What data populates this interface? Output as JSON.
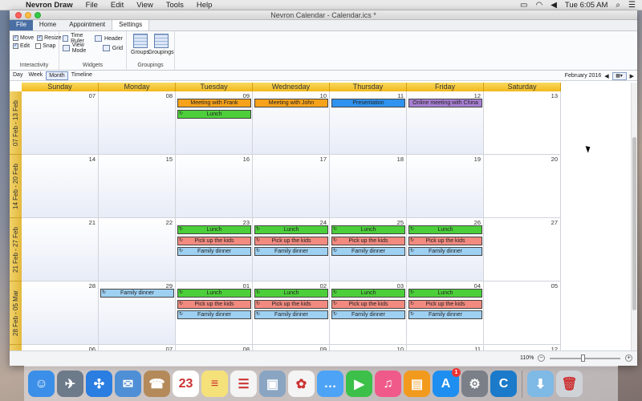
{
  "menubar": {
    "app_name": "Nevron Draw",
    "items": [
      "File",
      "Edit",
      "View",
      "Tools",
      "Help"
    ],
    "clock": "Tue 6:05 AM"
  },
  "window": {
    "title": "Nevron Calendar - Calendar.ics *"
  },
  "ribbon": {
    "tabs": [
      "File",
      "Home",
      "Appointment",
      "Settings"
    ],
    "interactivity": {
      "move": "Move",
      "resize": "Resize",
      "edit": "Edit",
      "snap": "Snap",
      "label": "Interactivity"
    },
    "widgets": {
      "time_ruler": "Time Ruler",
      "header": "Header",
      "view_mode": "View Mode",
      "grid": "Grid",
      "label": "Widgets"
    },
    "groupings": {
      "groups": "Groups",
      "groupings": "Groupings",
      "label": "Groupings"
    }
  },
  "viewbar": {
    "modes": [
      "Day",
      "Week",
      "Month",
      "Timeline"
    ],
    "selected": "Month",
    "period": "February 2016"
  },
  "calendar": {
    "day_headers": [
      "Sunday",
      "Monday",
      "Tuesday",
      "Wednesday",
      "Thursday",
      "Friday",
      "Saturday"
    ],
    "weeks": [
      {
        "label": "07 Feb - 13 Feb",
        "days": [
          "07",
          "08",
          "09",
          "10",
          "11",
          "12",
          "13"
        ]
      },
      {
        "label": "14 Feb - 20 Feb",
        "days": [
          "14",
          "15",
          "16",
          "17",
          "18",
          "19",
          "20"
        ]
      },
      {
        "label": "21 Feb - 27 Feb",
        "days": [
          "21",
          "22",
          "23",
          "24",
          "25",
          "26",
          "27"
        ]
      },
      {
        "label": "28 Feb - 05 Mar",
        "days": [
          "28",
          "29",
          "01",
          "02",
          "03",
          "04",
          "05"
        ]
      },
      {
        "label": "",
        "days": [
          "06",
          "07",
          "08",
          "09",
          "10",
          "11",
          "12"
        ]
      }
    ],
    "appointments": [
      {
        "week": 0,
        "day": 2,
        "slot": 0,
        "text": "Meeting with Frank",
        "color": "#f7a21b",
        "recurring": false
      },
      {
        "week": 0,
        "day": 2,
        "slot": 1,
        "text": "Lunch",
        "color": "#4ccf3a",
        "recurring": true
      },
      {
        "week": 0,
        "day": 3,
        "slot": 0,
        "text": "Meeting with John",
        "color": "#f7a21b",
        "recurring": false
      },
      {
        "week": 0,
        "day": 4,
        "slot": 0,
        "text": "Presentation",
        "color": "#2f93ef",
        "recurring": false
      },
      {
        "week": 0,
        "day": 5,
        "slot": 0,
        "text": "Online meeting with China",
        "color": "#a77fd2",
        "recurring": false
      },
      {
        "week": 2,
        "day": 2,
        "slot": 0,
        "text": "Lunch",
        "color": "#4ccf3a",
        "recurring": true
      },
      {
        "week": 2,
        "day": 2,
        "slot": 1,
        "text": "Pick up the kids",
        "color": "#f28a80",
        "recurring": true
      },
      {
        "week": 2,
        "day": 2,
        "slot": 2,
        "text": "Family dinner",
        "color": "#9ed0f2",
        "recurring": true
      },
      {
        "week": 2,
        "day": 3,
        "slot": 0,
        "text": "Lunch",
        "color": "#4ccf3a",
        "recurring": true
      },
      {
        "week": 2,
        "day": 3,
        "slot": 1,
        "text": "Pick up the kids",
        "color": "#f28a80",
        "recurring": true
      },
      {
        "week": 2,
        "day": 3,
        "slot": 2,
        "text": "Family dinner",
        "color": "#9ed0f2",
        "recurring": true
      },
      {
        "week": 2,
        "day": 4,
        "slot": 0,
        "text": "Lunch",
        "color": "#4ccf3a",
        "recurring": true
      },
      {
        "week": 2,
        "day": 4,
        "slot": 1,
        "text": "Pick up the kids",
        "color": "#f28a80",
        "recurring": true
      },
      {
        "week": 2,
        "day": 4,
        "slot": 2,
        "text": "Family dinner",
        "color": "#9ed0f2",
        "recurring": true
      },
      {
        "week": 2,
        "day": 5,
        "slot": 0,
        "text": "Lunch",
        "color": "#4ccf3a",
        "recurring": true
      },
      {
        "week": 2,
        "day": 5,
        "slot": 1,
        "text": "Pick up the kids",
        "color": "#f28a80",
        "recurring": true
      },
      {
        "week": 2,
        "day": 5,
        "slot": 2,
        "text": "Family dinner",
        "color": "#9ed0f2",
        "recurring": true
      },
      {
        "week": 3,
        "day": 1,
        "slot": 0,
        "text": "Family dinner",
        "color": "#9ed0f2",
        "recurring": true
      },
      {
        "week": 3,
        "day": 2,
        "slot": 0,
        "text": "Lunch",
        "color": "#4ccf3a",
        "recurring": true
      },
      {
        "week": 3,
        "day": 2,
        "slot": 1,
        "text": "Pick up the kids",
        "color": "#f28a80",
        "recurring": true
      },
      {
        "week": 3,
        "day": 2,
        "slot": 2,
        "text": "Family dinner",
        "color": "#9ed0f2",
        "recurring": true
      },
      {
        "week": 3,
        "day": 3,
        "slot": 0,
        "text": "Lunch",
        "color": "#4ccf3a",
        "recurring": true
      },
      {
        "week": 3,
        "day": 3,
        "slot": 1,
        "text": "Pick up the kids",
        "color": "#f28a80",
        "recurring": true
      },
      {
        "week": 3,
        "day": 3,
        "slot": 2,
        "text": "Family dinner",
        "color": "#9ed0f2",
        "recurring": true
      },
      {
        "week": 3,
        "day": 4,
        "slot": 0,
        "text": "Lunch",
        "color": "#4ccf3a",
        "recurring": true
      },
      {
        "week": 3,
        "day": 4,
        "slot": 1,
        "text": "Pick up the kids",
        "color": "#f28a80",
        "recurring": true
      },
      {
        "week": 3,
        "day": 4,
        "slot": 2,
        "text": "Family dinner",
        "color": "#9ed0f2",
        "recurring": true
      },
      {
        "week": 3,
        "day": 5,
        "slot": 0,
        "text": "Lunch",
        "color": "#4ccf3a",
        "recurring": true
      },
      {
        "week": 3,
        "day": 5,
        "slot": 1,
        "text": "Pick up the kids",
        "color": "#f28a80",
        "recurring": true
      },
      {
        "week": 3,
        "day": 5,
        "slot": 2,
        "text": "Family dinner",
        "color": "#9ed0f2",
        "recurring": true
      }
    ]
  },
  "statusbar": {
    "zoom": "110%",
    "zoom_level": 0.48
  },
  "dock": {
    "apps": [
      {
        "name": "finder-icon",
        "color": "#3b8fe8",
        "glyph": "☺"
      },
      {
        "name": "launchpad-icon",
        "color": "#6c7a8a",
        "glyph": "✈"
      },
      {
        "name": "safari-icon",
        "color": "#2a7de1",
        "glyph": "✣"
      },
      {
        "name": "mail-icon",
        "color": "#4f8fd6",
        "glyph": "✉"
      },
      {
        "name": "contacts-icon",
        "color": "#b48a5a",
        "glyph": "☎"
      },
      {
        "name": "calendar-icon",
        "color": "#ffffff",
        "glyph": "23"
      },
      {
        "name": "notes-icon",
        "color": "#f5e17a",
        "glyph": "≡"
      },
      {
        "name": "reminders-icon",
        "color": "#f4f4f4",
        "glyph": "☰"
      },
      {
        "name": "preview-icon",
        "color": "#8aa5c2",
        "glyph": "▣"
      },
      {
        "name": "photos-icon",
        "color": "#f4f4f4",
        "glyph": "✿"
      },
      {
        "name": "messages-icon",
        "color": "#4da3f5",
        "glyph": "…"
      },
      {
        "name": "facetime-icon",
        "color": "#3cc04a",
        "glyph": "▶"
      },
      {
        "name": "itunes-icon",
        "color": "#f05a8a",
        "glyph": "♫"
      },
      {
        "name": "ibooks-icon",
        "color": "#f29a1e",
        "glyph": "▤"
      },
      {
        "name": "app-store-icon",
        "color": "#1e8ff0",
        "glyph": "A",
        "badge": "1"
      },
      {
        "name": "system-preferences-icon",
        "color": "#7a7f88",
        "glyph": "⚙"
      },
      {
        "name": "nevron-icon",
        "color": "#1b7ac9",
        "glyph": "C"
      }
    ],
    "trash": [
      {
        "name": "downloads-folder-icon",
        "color": "#7fb9e6",
        "glyph": "⬇"
      },
      {
        "name": "trash-icon",
        "color": "#cfd3d8",
        "glyph": "🗑"
      }
    ]
  }
}
